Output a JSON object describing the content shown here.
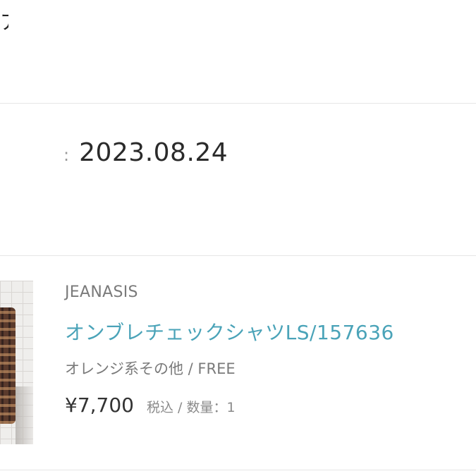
{
  "header": {
    "title_fragment": "ア"
  },
  "order": {
    "date_separator": ":",
    "date": "2023.08.24"
  },
  "product": {
    "brand": "JEANASIS",
    "name": "オンブレチェックシャツLS/157636",
    "variant": "オレンジ系その他 / FREE",
    "price": "¥7,700",
    "tax_quantity": "税込 / 数量：1",
    "link_color": "#4aa3b8"
  }
}
